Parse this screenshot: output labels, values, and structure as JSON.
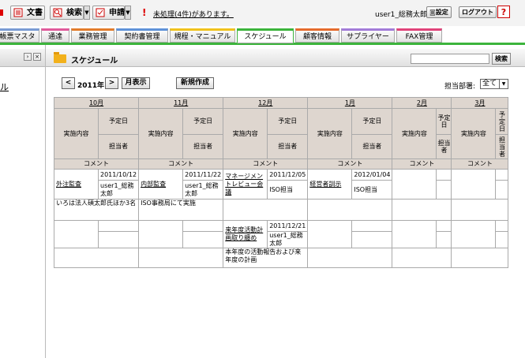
{
  "toolbar": {
    "doc": "文書",
    "search": "検索",
    "apply": "申請",
    "warning_mark": "!",
    "warning": "未処理(4件)があります。",
    "user": "user1_総務太郎",
    "settings": "設定",
    "logout": "ログアウト",
    "help": "?"
  },
  "tabs": [
    {
      "label": "帳票マスタ",
      "color": "#7a9bd3"
    },
    {
      "label": "通達",
      "color": "#e05a9b"
    },
    {
      "label": "業務管理",
      "color": "#e27b2b"
    },
    {
      "label": "契約書管理",
      "color": "#5f92d8"
    },
    {
      "label": "規程・マニュアル",
      "color": "#f0c21c"
    },
    {
      "label": "スケジュール",
      "color": "#3cb43c"
    },
    {
      "label": "顧客情報",
      "color": "#e56b2d"
    },
    {
      "label": "サプライヤー",
      "color": "#a27bd8"
    },
    {
      "label": "FAX管理",
      "color": "#e0437a"
    }
  ],
  "left": {
    "text": "ル"
  },
  "header": {
    "title": "スケジュール",
    "search_btn": "検索"
  },
  "nav": {
    "prev": "<",
    "year": "2011年",
    "next": ">",
    "month_view": "月表示",
    "new": "新規作成",
    "dept_label": "担当部署:",
    "dept_value": "全て",
    "dept_arrow": "▼"
  },
  "months": [
    {
      "name": "10月",
      "scheduled_date": "予定日",
      "assignee": "担当者"
    },
    {
      "name": "11月",
      "scheduled_date": "予定日",
      "assignee": "担当者"
    },
    {
      "name": "12月",
      "scheduled_date": "予定日",
      "assignee": "担当者"
    },
    {
      "name": "1月",
      "scheduled_date": "予定日",
      "assignee": "担当者"
    },
    {
      "name": "2月",
      "scheduled_date": "予定日",
      "assignee": "担当者"
    },
    {
      "name": "3月",
      "scheduled_date": "予定日",
      "assignee": "担当者"
    }
  ],
  "labels": {
    "content": "実施内容",
    "comment": "コメント"
  },
  "row1": {
    "oct": {
      "task": "外注監査",
      "date": "2011/10/12",
      "assignee": "user1_総務太郎"
    },
    "nov": {
      "task": "内部監査",
      "date": "2011/11/22",
      "assignee": "user1_総務太郎"
    },
    "dec": {
      "task": "マネージメントレビュー会議",
      "date": "2011/12/05",
      "assignee": "ISO担当"
    },
    "jan": {
      "task": "経営者訓示",
      "date": "2012/01/04",
      "assignee": "ISO担当"
    },
    "oct_comment": "いろは法人碩太郎氏ほか3名",
    "nov_comment": "ISO事務局にて実施"
  },
  "row2": {
    "dec": {
      "task": "来年度活動計画取り纏め",
      "date": "2011/12/21",
      "assignee": "user1_総務太郎"
    },
    "dec_comment": "本年度の活動報告および来年度の計画"
  }
}
